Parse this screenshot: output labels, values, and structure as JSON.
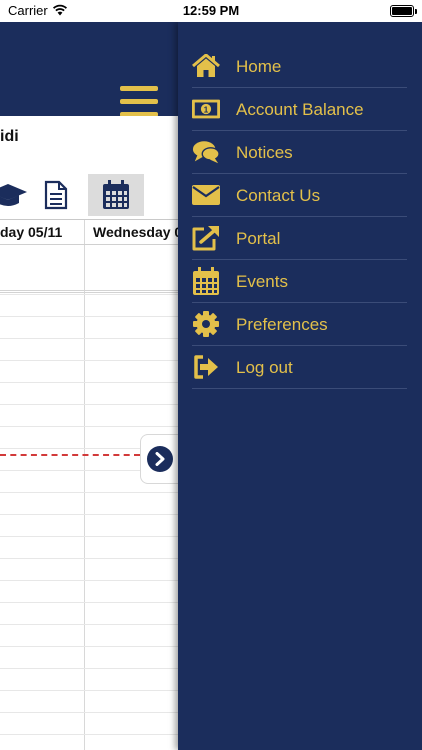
{
  "status_bar": {
    "carrier": "Carrier",
    "time": "12:59 PM"
  },
  "student": {
    "name_fragment": "idi"
  },
  "calendar": {
    "days": [
      "day 05/11",
      "Wednesday 0"
    ]
  },
  "menu": {
    "items": [
      {
        "label": "Home",
        "icon": "home-icon"
      },
      {
        "label": "Account Balance",
        "icon": "money-icon"
      },
      {
        "label": "Notices",
        "icon": "chat-bubbles-icon"
      },
      {
        "label": "Contact Us",
        "icon": "envelope-icon"
      },
      {
        "label": "Portal",
        "icon": "external-link-icon"
      },
      {
        "label": "Events",
        "icon": "calendar-icon"
      },
      {
        "label": "Preferences",
        "icon": "gear-icon"
      },
      {
        "label": "Log out",
        "icon": "sign-out-icon"
      }
    ]
  },
  "colors": {
    "navy": "#1b2d5c",
    "gold": "#e3c04a",
    "now_line": "#d23a3a"
  }
}
